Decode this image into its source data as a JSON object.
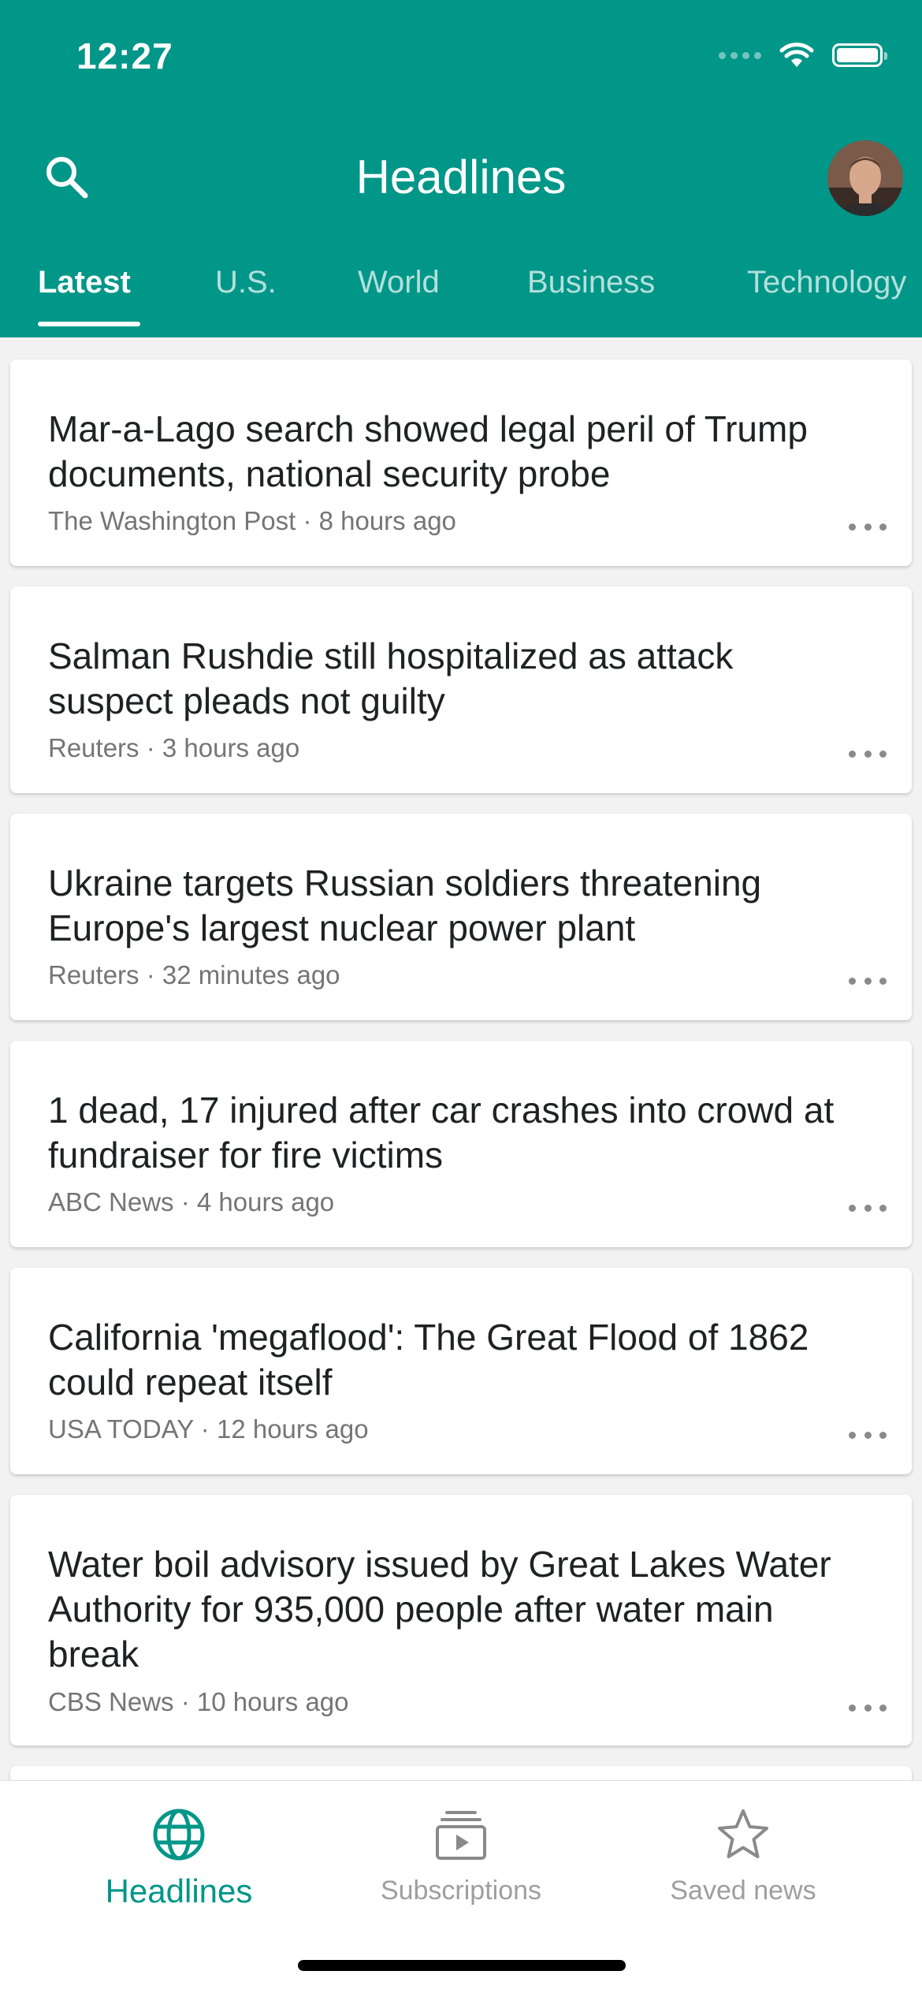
{
  "status_bar": {
    "time": "12:27"
  },
  "header": {
    "title": "Headlines"
  },
  "tabs": [
    {
      "label": "Latest",
      "active": true
    },
    {
      "label": "U.S.",
      "active": false
    },
    {
      "label": "World",
      "active": false
    },
    {
      "label": "Business",
      "active": false
    },
    {
      "label": "Technology",
      "active": false
    }
  ],
  "articles": [
    {
      "title": "Mar-a-Lago search showed legal peril of Trump documents, national security probe",
      "source": "The Washington Post",
      "time": "8 hours ago",
      "meta": "The Washington Post · 8 hours ago"
    },
    {
      "title": "Salman Rushdie still hospitalized as attack suspect pleads not guilty",
      "source": "Reuters",
      "time": "3 hours ago",
      "meta": "Reuters · 3 hours ago"
    },
    {
      "title": "Ukraine targets Russian soldiers threatening Europe's largest nuclear power plant",
      "source": "Reuters",
      "time": "32 minutes ago",
      "meta": "Reuters · 32 minutes ago"
    },
    {
      "title": "1 dead, 17 injured after car crashes into crowd at fundraiser for fire victims",
      "source": "ABC News",
      "time": "4 hours ago",
      "meta": "ABC News · 4 hours ago"
    },
    {
      "title": "California 'megaflood': The Great Flood of 1862 could repeat itself",
      "source": "USA TODAY",
      "time": "12 hours ago",
      "meta": "USA TODAY · 12 hours ago"
    },
    {
      "title": "Water boil advisory issued by Great Lakes Water Authority for 935,000 people after water main break",
      "source": "CBS News",
      "time": "10 hours ago",
      "meta": "CBS News · 10 hours ago"
    }
  ],
  "bottom_nav": [
    {
      "label": "Headlines",
      "icon": "globe-icon",
      "active": true
    },
    {
      "label": "Subscriptions",
      "icon": "subscriptions-icon",
      "active": false
    },
    {
      "label": "Saved news",
      "icon": "star-icon",
      "active": false
    }
  ],
  "colors": {
    "accent": "#009688",
    "text": "#202124",
    "meta": "#757575",
    "inactive": "#9e9e9e"
  }
}
